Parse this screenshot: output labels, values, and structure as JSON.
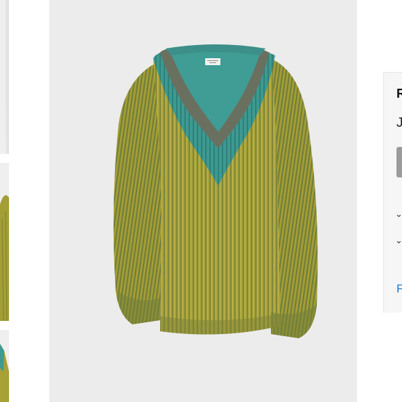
{
  "info_panel": {
    "brand": "R",
    "product_name": "J",
    "size_button_label": "",
    "link_text": "F"
  },
  "icons": {
    "chevron": "chevron-down-icon",
    "chevron_glyph": "⌄"
  },
  "colors": {
    "sweater_body": "#a6a12e",
    "sweater_rib_dark": "#6f7a3a",
    "neckline_teal": "#3f9a92",
    "neckline_grey": "#6b6f5a",
    "background": "#ececec",
    "link": "#1a7bd6"
  }
}
